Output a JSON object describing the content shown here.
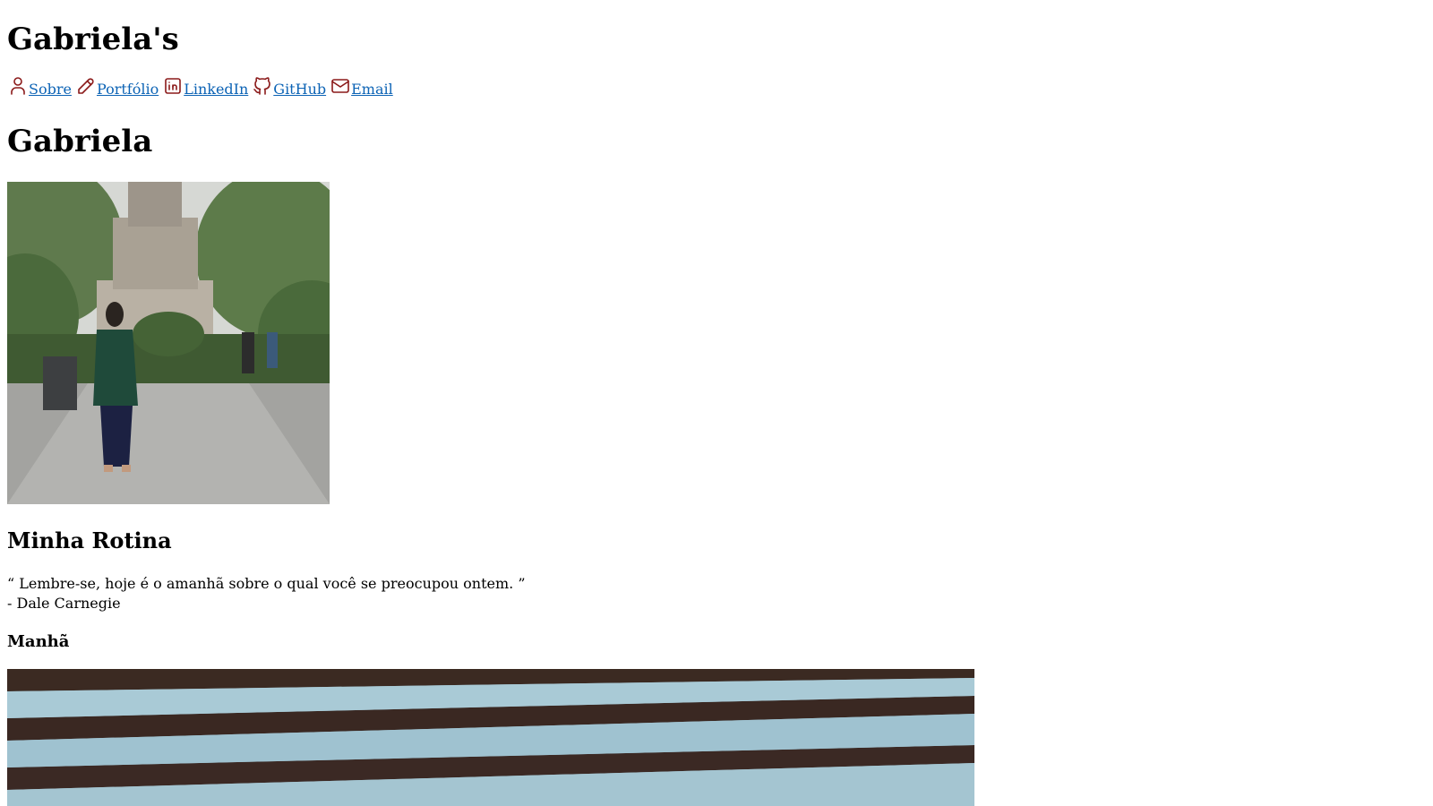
{
  "header": {
    "site_title": "Gabriela's"
  },
  "nav": {
    "items": [
      {
        "label": "Sobre",
        "icon": "person-icon"
      },
      {
        "label": "Portfólio",
        "icon": "pencil-icon"
      },
      {
        "label": "LinkedIn",
        "icon": "linkedin-icon"
      },
      {
        "label": "GitHub",
        "icon": "github-icon"
      },
      {
        "label": "Email",
        "icon": "mail-icon"
      }
    ],
    "link_color": "#0c63b5",
    "icon_color": "#8b1a1a"
  },
  "main": {
    "name": "Gabriela",
    "section_title": "Minha Rotina",
    "quote_text": "“ Lembre-se, hoje é o amanhã sobre o qual você se preocupou ontem. ”",
    "quote_author": "- Dale Carnegie",
    "subsection_title": "Manhã"
  }
}
